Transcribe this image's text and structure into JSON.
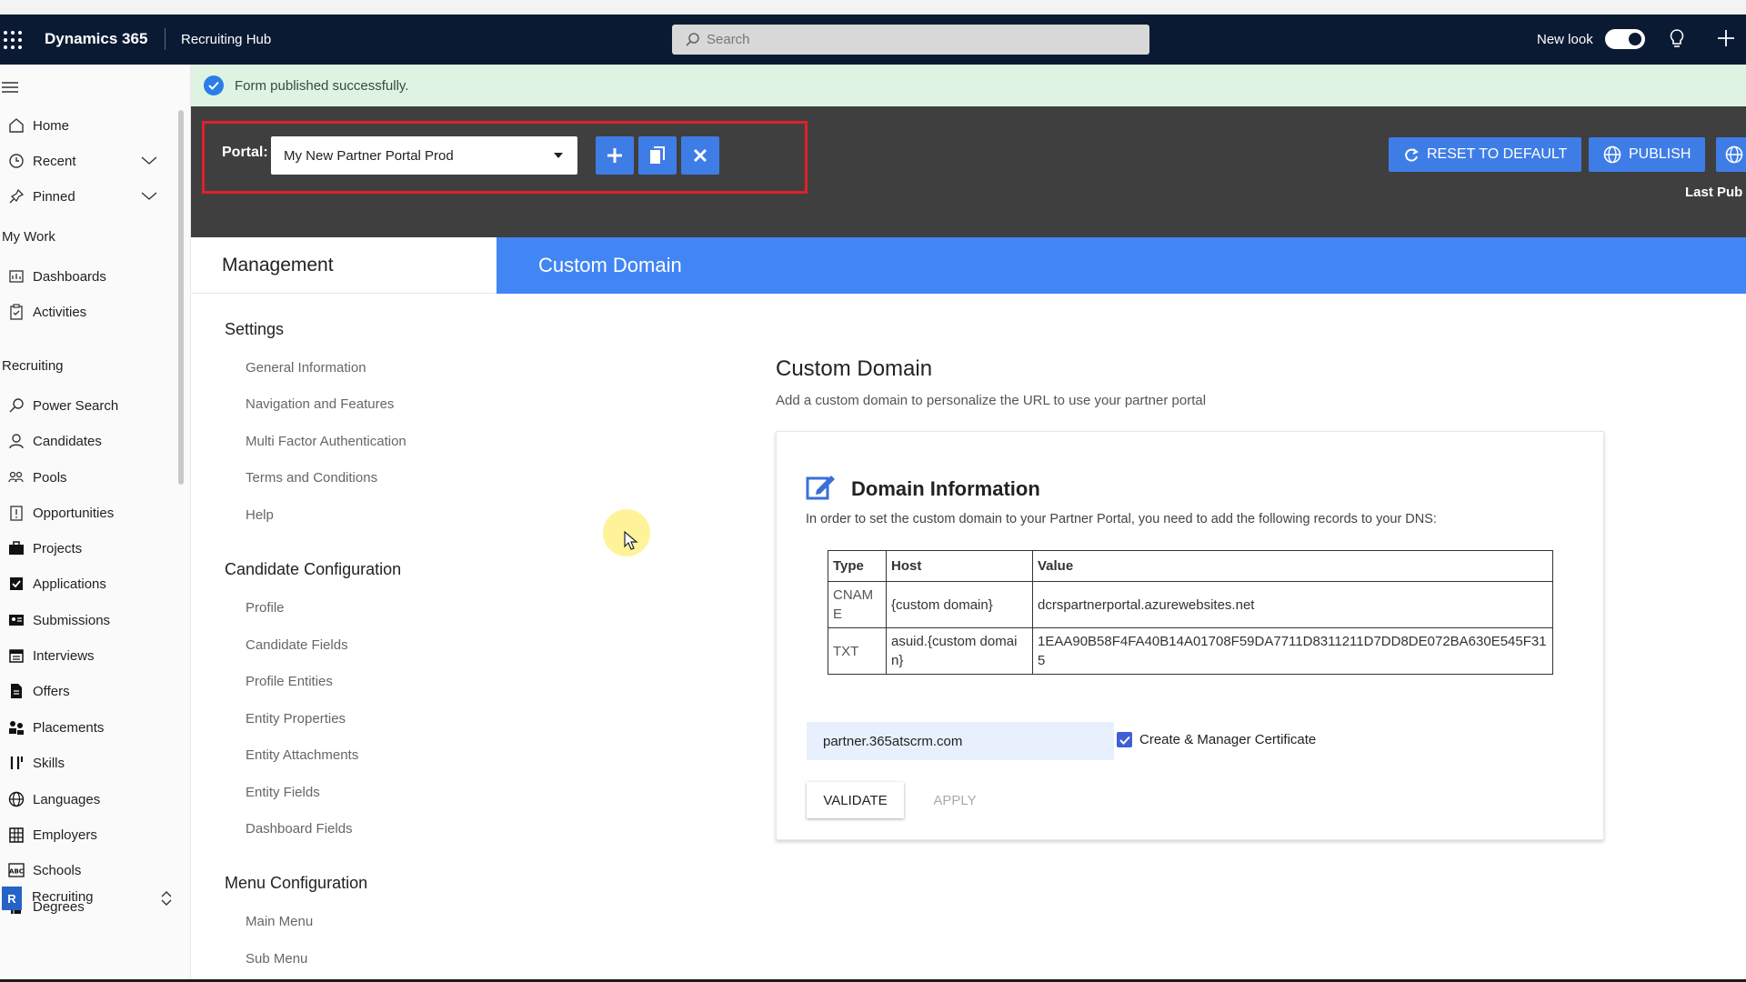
{
  "topbar": {
    "brand": "Dynamics 365",
    "app_name": "Recruiting Hub",
    "search_placeholder": "Search",
    "new_look_label": "New look"
  },
  "notification": {
    "message": "Form published successfully."
  },
  "leftnav": {
    "items_top": [
      {
        "label": "Home",
        "icon": "home-icon"
      },
      {
        "label": "Recent",
        "icon": "clock-icon"
      },
      {
        "label": "Pinned",
        "icon": "pin-icon"
      }
    ],
    "my_work_header": "My Work",
    "my_work": [
      {
        "label": "Dashboards",
        "icon": "dashboard-icon"
      },
      {
        "label": "Activities",
        "icon": "clipboard-icon"
      }
    ],
    "recruiting_header": "Recruiting",
    "recruiting": [
      {
        "label": "Power Search",
        "icon": "search-icon"
      },
      {
        "label": "Candidates",
        "icon": "person-icon"
      },
      {
        "label": "Pools",
        "icon": "people-icon"
      },
      {
        "label": "Opportunities",
        "icon": "exclamation-doc-icon"
      },
      {
        "label": "Projects",
        "icon": "briefcase-icon"
      },
      {
        "label": "Applications",
        "icon": "checkbox-icon"
      },
      {
        "label": "Submissions",
        "icon": "id-card-icon"
      },
      {
        "label": "Interviews",
        "icon": "calendar-icon"
      },
      {
        "label": "Offers",
        "icon": "document-icon"
      },
      {
        "label": "Placements",
        "icon": "placement-icon"
      },
      {
        "label": "Skills",
        "icon": "tools-icon"
      },
      {
        "label": "Languages",
        "icon": "globe-icon"
      },
      {
        "label": "Employers",
        "icon": "building-icon"
      },
      {
        "label": "Schools",
        "icon": "abc-icon"
      },
      {
        "label": "Degrees",
        "icon": "book-icon"
      }
    ],
    "area_badge": "R",
    "area_label": "Recruiting"
  },
  "toolbar": {
    "portal_label": "Portal:",
    "portal_value": "My New Partner Portal Prod",
    "reset_label": "RESET TO DEFAULT",
    "publish_label": "PUBLISH",
    "last_published_label": "Last Pub"
  },
  "management": {
    "title": "Management",
    "sections": [
      {
        "title": "Settings",
        "items": [
          "General Information",
          "Navigation and Features",
          "Multi Factor Authentication",
          "Terms and Conditions",
          "Help"
        ]
      },
      {
        "title": "Candidate Configuration",
        "items": [
          "Profile",
          "Candidate Fields",
          "Profile Entities",
          "Entity Properties",
          "Entity Attachments",
          "Entity Fields",
          "Dashboard Fields"
        ]
      },
      {
        "title": "Menu Configuration",
        "items": [
          "Main Menu",
          "Sub Menu"
        ]
      }
    ]
  },
  "content": {
    "header": "Custom Domain",
    "title": "Custom Domain",
    "subtitle": "Add a custom domain to personalize the URL to use your partner portal",
    "card": {
      "title": "Domain Information",
      "description": "In order to set the custom domain to your Partner Portal, you need to add the following records to your DNS:",
      "table_headers": [
        "Type",
        "Host",
        "Value"
      ],
      "rows": [
        {
          "type": "CNAME",
          "host": "{custom domain}",
          "value": "dcrspartnerportal.azurewebsites.net"
        },
        {
          "type": "TXT",
          "host": "asuid.{custom domain}",
          "value": "1EAA90B58F4FA40B14A01708F59DA7711D8311211D7DD8DE072BA630E545F315"
        }
      ],
      "domain_value": "partner.365atscrm.com",
      "certificate_label": "Create & Manager Certificate",
      "certificate_checked": true,
      "validate_label": "VALIDATE",
      "apply_label": "APPLY"
    }
  },
  "colors": {
    "accent": "#4285f4",
    "topbar": "#0b1a33",
    "toolbar_bg": "#3f3f3f",
    "highlight_box": "#e0202a",
    "success_bg": "#dff3e3"
  }
}
